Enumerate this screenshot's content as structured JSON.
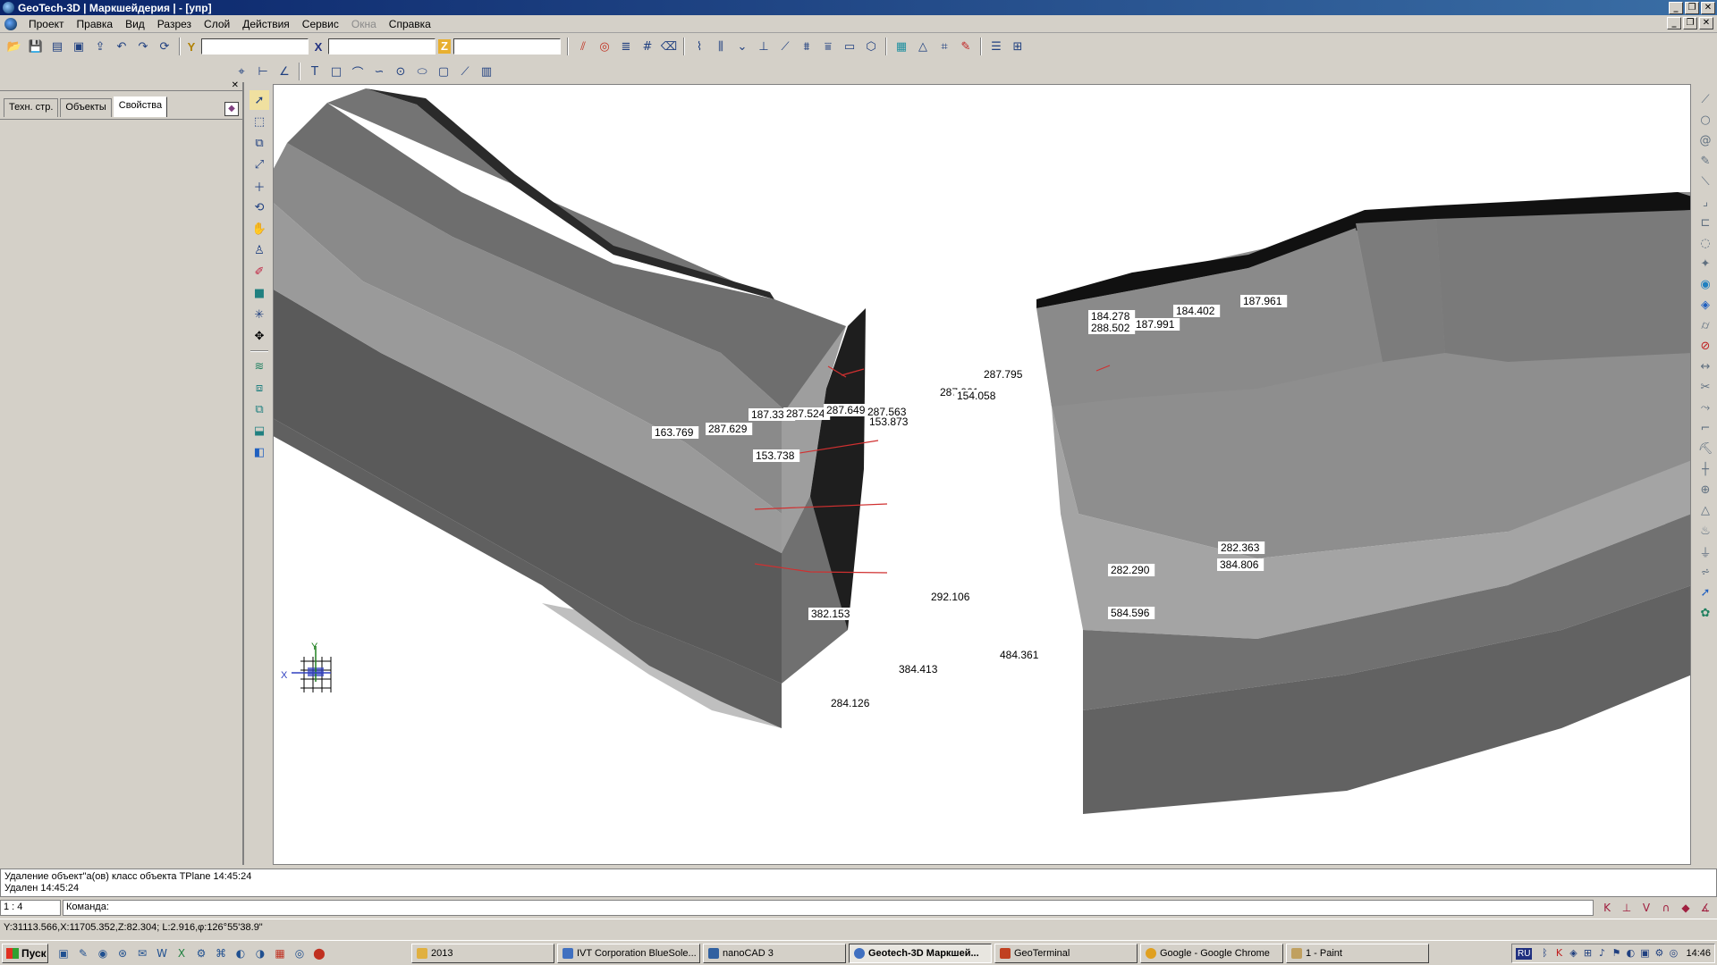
{
  "window": {
    "title": "GeoTech-3D | Маркшейдерия | - [упр]",
    "controls": [
      "_",
      "❐",
      "✕"
    ]
  },
  "menu": [
    {
      "label": "Проект",
      "enabled": true
    },
    {
      "label": "Правка",
      "enabled": true
    },
    {
      "label": "Вид",
      "enabled": true
    },
    {
      "label": "Разрез",
      "enabled": true
    },
    {
      "label": "Слой",
      "enabled": true
    },
    {
      "label": "Действия",
      "enabled": true
    },
    {
      "label": "Сервис",
      "enabled": true
    },
    {
      "label": "Окна",
      "enabled": false
    },
    {
      "label": "Справка",
      "enabled": true
    }
  ],
  "coords": {
    "y_label": "Y",
    "x_label": "X",
    "z_label": "Z",
    "y_value": "",
    "x_value": "",
    "z_value": ""
  },
  "panel": {
    "tabs": [
      {
        "label": "Техн. стр.",
        "active": false
      },
      {
        "label": "Объекты",
        "active": false
      },
      {
        "label": "Свойства",
        "active": true
      }
    ]
  },
  "viewport": {
    "axis_y": "Y",
    "axis_x": "X",
    "labels": [
      {
        "text": "163.769"
      },
      {
        "text": "287.629"
      },
      {
        "text": "187.332"
      },
      {
        "text": "287.524"
      },
      {
        "text": "287.649"
      },
      {
        "text": "287.563"
      },
      {
        "text": "153.873"
      },
      {
        "text": "153.738"
      },
      {
        "text": "287.961"
      },
      {
        "text": "154.058"
      },
      {
        "text": "287.795"
      },
      {
        "text": "184.278"
      },
      {
        "text": "288.502"
      },
      {
        "text": "187.991"
      },
      {
        "text": "184.402"
      },
      {
        "text": "187.961"
      },
      {
        "text": "282.363"
      },
      {
        "text": "384.806"
      },
      {
        "text": "282.290"
      },
      {
        "text": "292.106"
      },
      {
        "text": "382.153"
      },
      {
        "text": "584.596"
      },
      {
        "text": "484.361"
      },
      {
        "text": "384.413"
      },
      {
        "text": "284.126"
      }
    ]
  },
  "output": {
    "lines": [
      "Удаление объект\"а(ов) класс объекта TPlane 14:45:24",
      "Удален 14:45:24"
    ]
  },
  "command": {
    "scale": "1 : 4",
    "prompt": "Команда:",
    "value": ""
  },
  "status": "Y:31113.566,X:11705.352,Z:82.304; L:2.916,φ:126°55'38.9\"",
  "taskbar": {
    "start": "Пуск",
    "tasks": [
      {
        "label": "2013",
        "active": false
      },
      {
        "label": "IVT Corporation BlueSole...",
        "active": false
      },
      {
        "label": "nanoCAD 3",
        "active": false
      },
      {
        "label": "Geotech-3D Маркшей...",
        "active": true
      },
      {
        "label": "GeoTerminal",
        "active": false
      },
      {
        "label": "Google - Google Chrome",
        "active": false
      },
      {
        "label": "1 - Paint",
        "active": false
      }
    ],
    "lang": "RU",
    "clock": "14:46"
  }
}
